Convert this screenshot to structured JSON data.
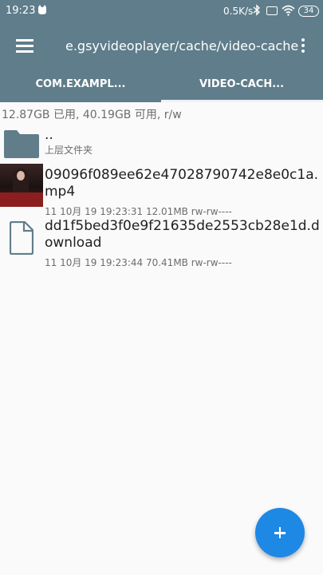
{
  "status_bar": {
    "time": "19:23",
    "network_speed": "0.5K/s",
    "battery": "34"
  },
  "toolbar": {
    "title": "e.gsyvideoplayer/cache/video-cache",
    "menu_icon": "hamburger-icon",
    "overflow_icon": "more-vert-icon"
  },
  "tabs": [
    {
      "label": "COM.EXAMPL...",
      "selected": false
    },
    {
      "label": "VIDEO-CACH...",
      "selected": true
    }
  ],
  "storage_info": "12.87GB 已用, 40.19GB 可用, r/w",
  "files": [
    {
      "name": "..",
      "meta": "上层文件夹",
      "icon": "folder-icon"
    },
    {
      "name": "09096f089ee62e47028790742e8e0c1a.mp4",
      "meta": "11 10月 19 19:23:31  12.01MB  rw-rw----",
      "icon": "video-thumbnail"
    },
    {
      "name": "dd1f5bed3f0e9f21635de2553cb28e1d.download",
      "meta": "11 10月 19 19:23:44  70.41MB  rw-rw----",
      "icon": "file-icon"
    }
  ],
  "fab": {
    "icon": "plus-icon"
  },
  "colors": {
    "primary": "#5f7d8b",
    "accent": "#1e88e5",
    "background": "#fafafa"
  }
}
